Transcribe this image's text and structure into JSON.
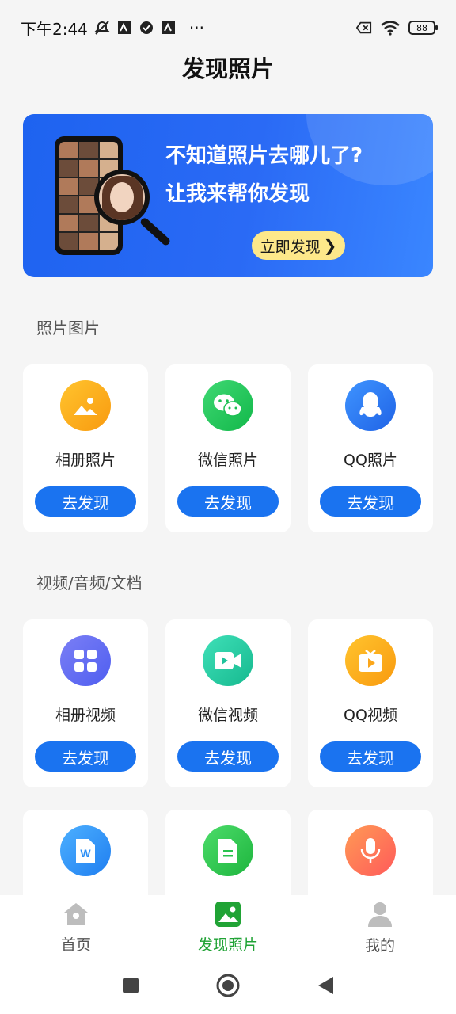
{
  "status_bar": {
    "time": "下午2:44",
    "more": "···",
    "battery": "88",
    "icons": [
      "mute-icon",
      "app-icon",
      "check-icon",
      "app-icon",
      "sim-x-icon",
      "wifi-icon",
      "battery-icon"
    ]
  },
  "page_title": "发现照片",
  "banner": {
    "line1": "不知道照片去哪儿了?",
    "line2": "让我来帮你发现",
    "button": "立即发现",
    "button_chevron": "❯",
    "colors": {
      "bg": "#1e63f0",
      "button_bg": "#fde88a"
    }
  },
  "sections": [
    {
      "title": "照片图片",
      "cards": [
        {
          "label": "相册照片",
          "button": "去发现",
          "icon": "gallery-icon",
          "color": "#fbab1c"
        },
        {
          "label": "微信照片",
          "button": "去发现",
          "icon": "wechat-icon",
          "color": "#21c65a"
        },
        {
          "label": "QQ照片",
          "button": "去发现",
          "icon": "qq-icon",
          "color": "#2b7af5"
        }
      ]
    },
    {
      "title": "视频/音频/文档",
      "cards": [
        {
          "label": "相册视频",
          "button": "去发现",
          "icon": "grid-icon",
          "color": "#5b6cf1"
        },
        {
          "label": "微信视频",
          "button": "去发现",
          "icon": "video-camera-icon",
          "color": "#24c9a4"
        },
        {
          "label": "QQ视频",
          "button": "去发现",
          "icon": "tv-play-icon",
          "color": "#fba61b"
        },
        {
          "label": "",
          "button": "",
          "icon": "word-doc-icon",
          "color": "#2b8ff6"
        },
        {
          "label": "",
          "button": "",
          "icon": "document-icon",
          "color": "#29c34e"
        },
        {
          "label": "",
          "button": "",
          "icon": "microphone-icon",
          "color": "#ff6b52"
        }
      ]
    }
  ],
  "bottom_nav": [
    {
      "label": "首页",
      "icon": "home-icon",
      "active": false
    },
    {
      "label": "发现照片",
      "icon": "photo-icon",
      "active": true
    },
    {
      "label": "我的",
      "icon": "profile-icon",
      "active": false
    }
  ],
  "colors": {
    "accent_blue": "#1a73f0",
    "active_green": "#20a335"
  }
}
